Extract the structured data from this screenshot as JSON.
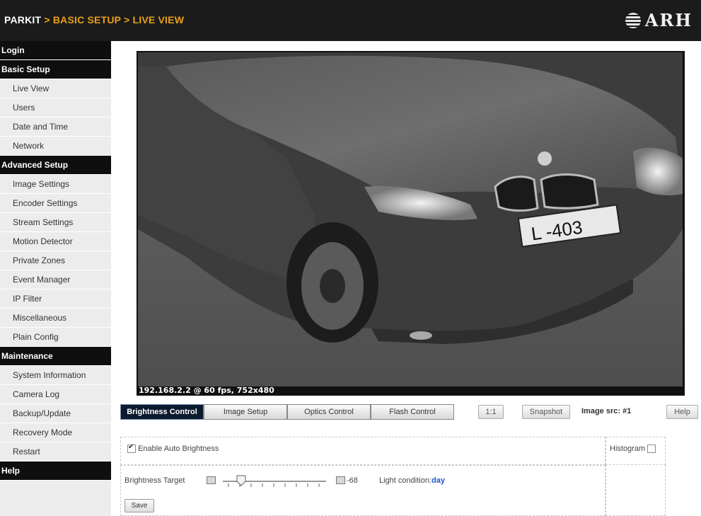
{
  "header": {
    "crumb_root": "PARKIT",
    "crumb_sep": ">",
    "crumb_section": "BASIC SETUP",
    "crumb_page": "LIVE VIEW",
    "logo_text": "ARH"
  },
  "sidebar": {
    "items": [
      {
        "label": "Login",
        "kind": "head"
      },
      {
        "label": "Basic Setup",
        "kind": "head"
      },
      {
        "label": "Live View",
        "kind": "item"
      },
      {
        "label": "Users",
        "kind": "item"
      },
      {
        "label": "Date and Time",
        "kind": "item"
      },
      {
        "label": "Network",
        "kind": "item"
      },
      {
        "label": "Advanced Setup",
        "kind": "head"
      },
      {
        "label": "Image Settings",
        "kind": "item"
      },
      {
        "label": "Encoder Settings",
        "kind": "item"
      },
      {
        "label": "Stream Settings",
        "kind": "item"
      },
      {
        "label": "Motion Detector",
        "kind": "item"
      },
      {
        "label": "Private Zones",
        "kind": "item"
      },
      {
        "label": "Event Manager",
        "kind": "item"
      },
      {
        "label": "IP Filter",
        "kind": "item"
      },
      {
        "label": "Miscellaneous",
        "kind": "item"
      },
      {
        "label": "Plain Config",
        "kind": "item"
      },
      {
        "label": "Maintenance",
        "kind": "head"
      },
      {
        "label": "System Information",
        "kind": "item"
      },
      {
        "label": "Camera Log",
        "kind": "item"
      },
      {
        "label": "Backup/Update",
        "kind": "item"
      },
      {
        "label": "Recovery Mode",
        "kind": "item"
      },
      {
        "label": "Restart",
        "kind": "item"
      },
      {
        "label": "Help",
        "kind": "head"
      }
    ]
  },
  "viewer": {
    "osd": "192.168.2.2 @ 60 fps, 752x480",
    "plate": "L -403"
  },
  "toolbar": {
    "tabs": [
      "Brightness Control",
      "Image Setup",
      "Optics Control",
      "Flash Control"
    ],
    "active_tab": 0,
    "ratio_button": "1:1",
    "snapshot_button": "Snapshot",
    "image_src": "Image src: #1",
    "help_button": "Help"
  },
  "brightness": {
    "enable_auto_label": "Enable Auto Brightness",
    "enable_auto_checked": true,
    "histogram_label": "Histogram",
    "histogram_checked": false,
    "target_label": "Brightness Target",
    "target_value": "-68",
    "light_condition_label": "Light condition:",
    "light_condition_value": "day",
    "save_button": "Save"
  },
  "colors": {
    "header_bg": "#1b1b1b",
    "crumb_accent": "#e8a018",
    "active_tab_bg": "#0d1a2e",
    "light_condition": "#2255cc"
  }
}
